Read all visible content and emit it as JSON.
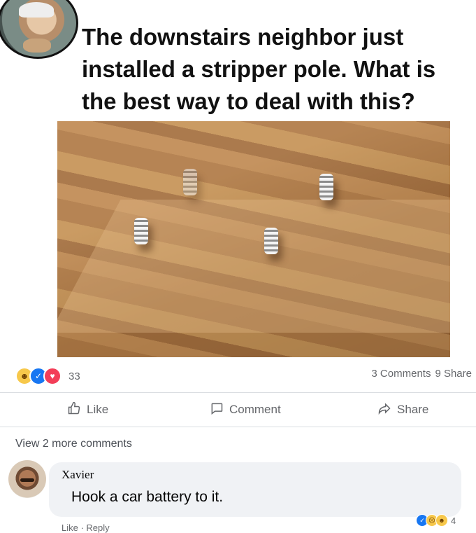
{
  "post": {
    "text": "The downstairs neighbor just installed a stripper pole. What is the best way to deal with this?"
  },
  "stats": {
    "reaction_count": "33",
    "comments": "3 Comments",
    "shares": "9 Share",
    "reaction_icons": [
      "haha-icon",
      "like-icon",
      "love-icon"
    ]
  },
  "actions": {
    "like": "Like",
    "comment": "Comment",
    "share": "Share"
  },
  "comments": {
    "view_more": "View 2 more comments",
    "items": [
      {
        "author": "Xavier",
        "text": "Hook a car battery to it.",
        "reaction_count": "4",
        "footer": "Like · Reply"
      }
    ]
  },
  "colors": {
    "brand_blue": "#1877f2",
    "love_red": "#f33e58",
    "haha_yellow": "#f7c84b",
    "bubble_gray": "#f0f2f5",
    "muted_text": "#65676b"
  }
}
